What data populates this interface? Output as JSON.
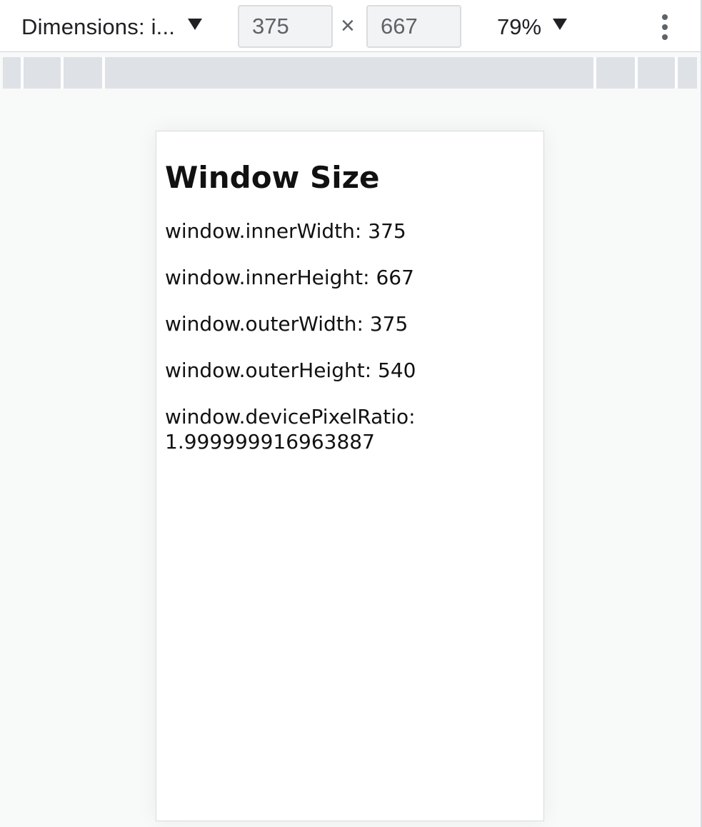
{
  "toolbar": {
    "device_label": "Dimensions: i...",
    "width_value": "375",
    "times_symbol": "×",
    "height_value": "667",
    "zoom_label": "79%",
    "dropdown_icon": "triangle-down-icon",
    "more_icon": "vertical-ellipsis-icon"
  },
  "page": {
    "title": "Window Size",
    "lines": [
      "window.innerWidth: 375",
      "window.innerHeight: 667",
      "window.outerWidth: 375",
      "window.outerHeight: 540",
      "window.devicePixelRatio: 1.999999916963887"
    ]
  },
  "colors": {
    "toolbar_bg": "#ffffff",
    "canvas_bg": "#f8f9f9",
    "media_query_bar": "#dee1e6",
    "input_bg": "#f1f3f4"
  }
}
